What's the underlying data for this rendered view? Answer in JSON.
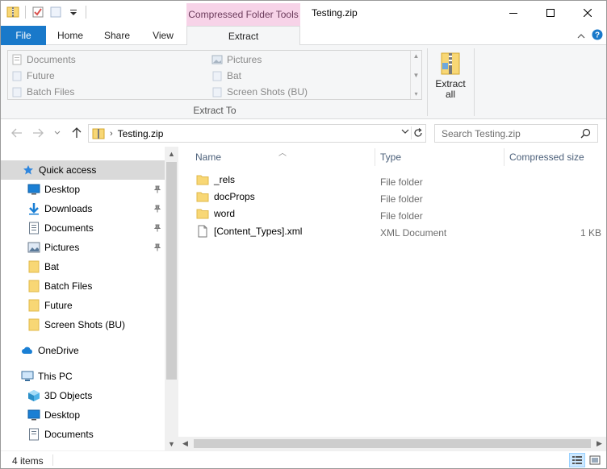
{
  "window": {
    "title": "Testing.zip",
    "context_tab_group": "Compressed Folder Tools"
  },
  "tabs": {
    "file": "File",
    "home": "Home",
    "share": "Share",
    "view": "View",
    "extract": "Extract"
  },
  "ribbon": {
    "destinations": [
      {
        "label": "Documents",
        "icon": "documents-icon"
      },
      {
        "label": "Pictures",
        "icon": "pictures-icon"
      },
      {
        "label": "Future",
        "icon": "folder-icon"
      },
      {
        "label": "Bat",
        "icon": "folder-icon"
      },
      {
        "label": "Batch Files",
        "icon": "folder-icon"
      },
      {
        "label": "Screen Shots (BU)",
        "icon": "folder-icon"
      }
    ],
    "group_label": "Extract To",
    "extract_all_line1": "Extract",
    "extract_all_line2": "all"
  },
  "address": {
    "crumb": "Testing.zip",
    "search_placeholder": "Search Testing.zip"
  },
  "nav": {
    "quick_access": "Quick access",
    "items": [
      {
        "label": "Desktop",
        "pinned": true
      },
      {
        "label": "Downloads",
        "pinned": true
      },
      {
        "label": "Documents",
        "pinned": true
      },
      {
        "label": "Pictures",
        "pinned": true
      },
      {
        "label": "Bat",
        "pinned": false
      },
      {
        "label": "Batch Files",
        "pinned": false
      },
      {
        "label": "Future",
        "pinned": false
      },
      {
        "label": "Screen Shots (BU)",
        "pinned": false
      }
    ],
    "onedrive": "OneDrive",
    "this_pc": "This PC",
    "pc_items": [
      {
        "label": "3D Objects"
      },
      {
        "label": "Desktop"
      },
      {
        "label": "Documents"
      }
    ]
  },
  "columns": {
    "name": "Name",
    "type": "Type",
    "size": "Compressed size"
  },
  "files": [
    {
      "name": "_rels",
      "type": "File folder",
      "size": "",
      "kind": "folder"
    },
    {
      "name": "docProps",
      "type": "File folder",
      "size": "",
      "kind": "folder"
    },
    {
      "name": "word",
      "type": "File folder",
      "size": "",
      "kind": "folder"
    },
    {
      "name": "[Content_Types].xml",
      "type": "XML Document",
      "size": "1 KB",
      "kind": "file"
    }
  ],
  "status": {
    "count": "4 items"
  },
  "colors": {
    "file_tab": "#1979ca",
    "context_tab": "#f7d3e8",
    "folder": "#f8d775",
    "selected": "#d9d9d9"
  }
}
